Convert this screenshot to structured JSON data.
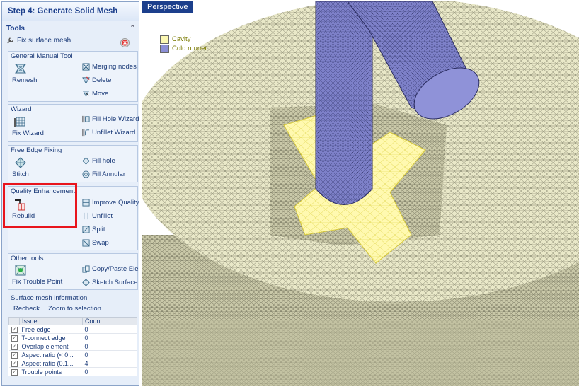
{
  "panel": {
    "title": "Step 4: Generate Solid Mesh",
    "tools_label": "Tools",
    "fix_surface_mesh": "Fix surface mesh"
  },
  "general": {
    "title": "General Manual Tool",
    "remesh": "Remesh",
    "merging_nodes": "Merging nodes",
    "delete": "Delete",
    "move": "Move"
  },
  "wizard": {
    "title": "Wizard",
    "fix_wizard": "Fix Wizard",
    "fill_hole_wizard": "Fill Hole Wizard",
    "unfillet_wizard": "Unfillet Wizard"
  },
  "free_edge": {
    "title": "Free Edge Fixing",
    "stitch": "Stitch",
    "fill_hole": "Fill hole",
    "fill_annular": "Fill Annular"
  },
  "quality": {
    "title": "Quality Enhancement",
    "rebuild": "Rebuild",
    "improve_quality": "Improve Quality",
    "unfillet": "Unfillet",
    "split": "Split",
    "swap": "Swap"
  },
  "other": {
    "title": "Other tools",
    "fix_trouble_point": "Fix Trouble Point",
    "copy_paste": "Copy/Paste Eler",
    "sketch_surface": "Sketch Surface"
  },
  "info": {
    "title": "Surface mesh information",
    "recheck": "Recheck",
    "zoom": "Zoom to selection",
    "col_issue": "Issue",
    "col_count": "Count",
    "rows": [
      {
        "issue": "Free edge",
        "count": "0"
      },
      {
        "issue": "T-connect edge",
        "count": "0"
      },
      {
        "issue": "Overlap element",
        "count": "0"
      },
      {
        "issue": "Aspect ratio (< 0...",
        "count": "0"
      },
      {
        "issue": "Aspect ratio (0.1...",
        "count": "4"
      },
      {
        "issue": "Trouble points",
        "count": "0"
      }
    ]
  },
  "viewport": {
    "tab": "Perspective",
    "legend": [
      {
        "label": "Cavity",
        "color": "#fbf7b2"
      },
      {
        "label": "Cold runner",
        "color": "#8c8fd6"
      }
    ]
  },
  "colors": {
    "accent": "#1c3f8c",
    "mesh_body": "#e9e8c8",
    "mesh_line": "#4a4a3a",
    "insert": "#fff9b0",
    "runner": "#7d80c8",
    "highlight": "#e8141c"
  }
}
